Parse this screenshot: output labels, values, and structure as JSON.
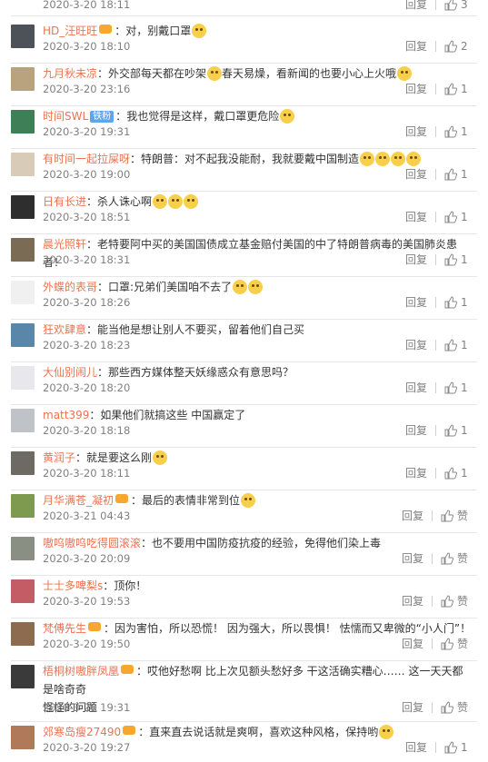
{
  "top_partial": {
    "time": "2020-3-20 18:11",
    "reply": "回复",
    "likes": "3"
  },
  "comments": [
    {
      "user": "HD_汪旺旺",
      "vip": true,
      "badge": "",
      "sep": "：",
      "text": "对，别戴口罩",
      "emojis": 1,
      "time": "2020-3-20 18:10",
      "reply": "回复",
      "likes": "2",
      "avatar": "#4d5158"
    },
    {
      "user": "九月秋未凉",
      "vip": false,
      "badge": "",
      "sep": "：",
      "text": "外交部每天都在吵架",
      "text2": "春天易燥，看新闻的也要小心上火哦",
      "emojis": 1,
      "emojis_end": 1,
      "time": "2020-3-20 23:16",
      "reply": "回复",
      "likes": "1",
      "avatar": "#b9a37e"
    },
    {
      "user": "时间SWL",
      "vip": false,
      "badge": "铁粉",
      "sep": "：",
      "text": "我也觉得是这样，戴口罩更危险",
      "emojis": 1,
      "time": "2020-3-20 19:31",
      "reply": "回复",
      "likes": "1",
      "avatar": "#3f7f57"
    },
    {
      "user": "有时间一起拉屎呀",
      "vip": false,
      "badge": "",
      "sep": "：",
      "text": "特朗普：对不起我没能耐，我就要戴中国制造",
      "emojis": 4,
      "time": "2020-3-20 19:00",
      "reply": "回复",
      "likes": "1",
      "avatar": "#d8cbb8"
    },
    {
      "user": "日有长进",
      "vip": false,
      "badge": "",
      "sep": "：",
      "text": "杀人诛心啊",
      "emojis": 3,
      "time": "2020-3-20 18:51",
      "reply": "回复",
      "likes": "1",
      "avatar": "#2e2e2e"
    },
    {
      "user": "晨光照轩",
      "vip": false,
      "badge": "",
      "sep": "：",
      "text": "老特要阿中买的美国国债成立基金赔付美国的中了特朗普病毒的美国肺炎患者！",
      "emojis": 0,
      "time": "2020-3-20 18:31",
      "reply": "回复",
      "likes": "1",
      "avatar": "#7a6b55"
    },
    {
      "user": "外蝶的表哥",
      "vip": false,
      "badge": "",
      "sep": "：",
      "text": "口罩:兄弟们美国咱不去了",
      "emojis": 2,
      "time": "2020-3-20 18:26",
      "reply": "回复",
      "likes": "1",
      "avatar": "#f0f0f0"
    },
    {
      "user": "狂欢肆意",
      "vip": false,
      "badge": "",
      "sep": "：",
      "text": "能当他是想让别人不要买，留着他们自己买",
      "emojis": 0,
      "time": "2020-3-20 18:23",
      "reply": "回复",
      "likes": "1",
      "avatar": "#5a86a8"
    },
    {
      "user": "大仙别闹儿",
      "vip": false,
      "badge": "",
      "sep": "：",
      "text": "那些西方媒体整天妖缘惑众有意思吗？",
      "emojis": 0,
      "time": "2020-3-20 18:20",
      "reply": "回复",
      "likes": "1",
      "avatar": "#e8e8ec"
    },
    {
      "user": "matt399",
      "vip": false,
      "badge": "",
      "sep": "：",
      "text": "如果他们就搞这些 中国赢定了",
      "emojis": 0,
      "time": "2020-3-20 18:18",
      "reply": "回复",
      "likes": "1",
      "avatar": "#bfc3c7"
    },
    {
      "user": "黄润子",
      "vip": false,
      "badge": "",
      "sep": "：",
      "text": "就是要这么刚",
      "emojis": 1,
      "time": "2020-3-20 18:11",
      "reply": "回复",
      "likes": "1",
      "avatar": "#6d6a63"
    },
    {
      "user": "月华满苍_凝初",
      "vip": true,
      "badge": "",
      "sep": "：",
      "text": "最后的表情非常到位",
      "emojis": 1,
      "time": "2020-3-21 04:43",
      "reply": "回复",
      "likes": "赞",
      "avatar": "#7e9a4f"
    },
    {
      "user": "嗷呜嗷呜吃得圆滚滚",
      "vip": false,
      "badge": "",
      "sep": "：",
      "text": "也不要用中国防疫抗疫的经验，免得他们染上毒",
      "emojis": 0,
      "time": "2020-3-20 20:09",
      "reply": "回复",
      "likes": "赞",
      "avatar": "#8a8f84"
    },
    {
      "user": "士士多啤梨s",
      "vip": false,
      "badge": "",
      "sep": "：",
      "text": "顶你！",
      "emojis": 0,
      "time": "2020-3-20 19:53",
      "reply": "回复",
      "likes": "赞",
      "avatar": "#c45c66"
    },
    {
      "user": "梵傅先生",
      "vip": true,
      "badge": "",
      "sep": "：",
      "text": "因为害怕，所以恐慌！ 因为强大，所以畏惧！ 怯懦而又卑微的“小人门”！",
      "emojis": 0,
      "time": "2020-3-20 19:50",
      "reply": "回复",
      "likes": "赞",
      "avatar": "#8c6b4f"
    },
    {
      "user": "梧桐树嗷胖凤凰",
      "vip": true,
      "badge": "",
      "sep": "：",
      "text": "哎他好愁啊 比上次见额头愁好多 干这活确实糟心…… 这一天天都是啥奇奇",
      "text_line2": "怪怪的问题",
      "emojis": 0,
      "time": "2020-3-20 19:31",
      "reply": "回复",
      "likes": "赞",
      "avatar": "#3a3a3a"
    },
    {
      "user": "郊寒岛瘦27490",
      "vip": true,
      "badge": "",
      "sep": "：",
      "text": "直来直去说话就是爽啊，喜欢这种风格，保持哟",
      "emojis": 1,
      "time": "2020-3-20 19:27",
      "reply": "回复",
      "likes": "1",
      "avatar": "#b07a5a"
    }
  ]
}
